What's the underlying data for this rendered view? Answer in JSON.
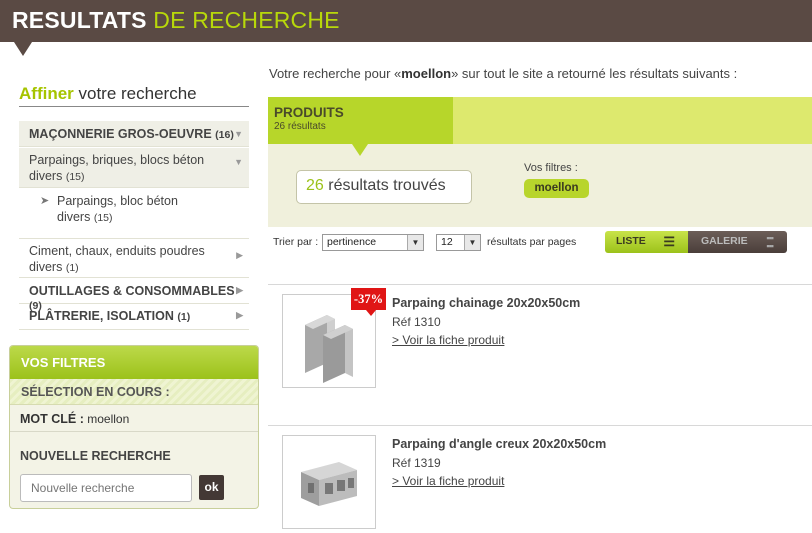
{
  "header": {
    "title_bold": "RESULTATS",
    "title_rest": " DE RECHERCHE"
  },
  "sidebar": {
    "refine_highlight": "Affiner",
    "refine_rest": " votre recherche",
    "categories": [
      {
        "label": "MAÇONNERIE GROS-OEUVRE",
        "count": "(16)"
      },
      {
        "label": "Parpaings, briques, blocs béton divers",
        "count": "(15)"
      },
      {
        "label": "Parpaings, bloc béton divers",
        "count": "(15)"
      },
      {
        "label": "Ciment, chaux, enduits poudres divers",
        "count": "(1)"
      },
      {
        "label": "OUTILLAGES & CONSOMMABLES",
        "count": "(9)"
      },
      {
        "label": "PLÂTRERIE, ISOLATION",
        "count": "(1)"
      }
    ],
    "filters": {
      "title": "VOS FILTRES",
      "selection_label": "SÉLECTION EN COURS :",
      "keyword_label": "MOT CLÉ :",
      "keyword_value": " moellon",
      "new_search_label": "NOUVELLE RECHERCHE",
      "search_placeholder": "Nouvelle recherche",
      "ok_label": "ok"
    }
  },
  "main": {
    "intro_before": "Votre recherche pour «",
    "intro_term": "moellon",
    "intro_after": "» sur tout le site a retourné les résultats suivants :",
    "tab_title": "PRODUITS",
    "tab_subtitle": "26 résultats",
    "results_count": "26",
    "results_label": " résultats trouvés",
    "filters_label": "Vos filtres :",
    "filter_chip": "moellon",
    "sort_label": "Trier par :",
    "sort_value": "pertinence",
    "per_page_value": "12",
    "per_page_label": "résultats par pages",
    "view_list": "LISTE",
    "view_gallery": "GALERIE",
    "products": [
      {
        "name": "Parpaing chainage 20x20x50cm",
        "ref": "Réf 1310",
        "link": "> Voir la fiche produit",
        "badge": "-37%"
      },
      {
        "name": "Parpaing d'angle creux 20x20x50cm",
        "ref": "Réf 1319",
        "link": "> Voir la fiche produit"
      }
    ]
  },
  "colors": {
    "brand_dark": "#5a4a44",
    "brand_green": "#b8d80a",
    "promo_red": "#e01515"
  }
}
